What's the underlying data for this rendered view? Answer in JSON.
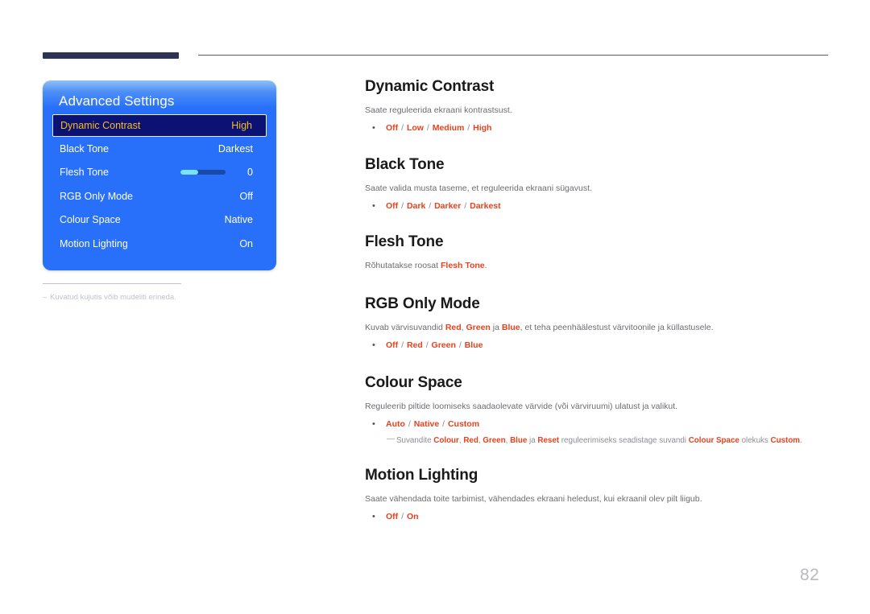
{
  "page": {
    "number": "82"
  },
  "osd": {
    "title": "Advanced Settings",
    "rows": [
      {
        "label": "Dynamic Contrast",
        "value": "High",
        "selected": true,
        "type": "value"
      },
      {
        "label": "Black Tone",
        "value": "Darkest",
        "selected": false,
        "type": "value"
      },
      {
        "label": "Flesh Tone",
        "value": "0",
        "selected": false,
        "type": "slider",
        "fill_percent": 40
      },
      {
        "label": "RGB Only Mode",
        "value": "Off",
        "selected": false,
        "type": "value"
      },
      {
        "label": "Colour Space",
        "value": "Native",
        "selected": false,
        "type": "value"
      },
      {
        "label": "Motion Lighting",
        "value": "On",
        "selected": false,
        "type": "value"
      }
    ],
    "note": {
      "dash": "–",
      "text": "Kuvatud kujutis võib mudeliti erineda."
    },
    "colors": {
      "panel_blue": "#2870fa",
      "selected_bg": "#0c1273",
      "selected_text": "#f5bd20",
      "slider_fill": "#7ae3ef",
      "slider_track": "#1a4aa8"
    }
  },
  "doc": {
    "accent_color": "#e8421d",
    "sections": [
      {
        "title": "Dynamic Contrast",
        "desc_prefix": "Saate reguleerida ekraani kontrastsust.",
        "bullet_dot": "•",
        "options": [
          "Off",
          "Low",
          "Medium",
          "High"
        ],
        "separator": "/"
      },
      {
        "title": "Black Tone",
        "desc_prefix": "Saate valida musta taseme, et reguleerida ekraani sügavust.",
        "bullet_dot": "•",
        "options": [
          "Off",
          "Dark",
          "Darker",
          "Darkest"
        ],
        "separator": "/"
      },
      {
        "title": "Flesh Tone",
        "desc_prefix": "Rõhutatakse roosat ",
        "desc_highlight": "Flesh Tone",
        "desc_suffix": ".",
        "options": [],
        "separator": "/"
      },
      {
        "title": "RGB Only Mode",
        "desc_part1": "Kuvab värvisuvandid ",
        "desc_hl1": "Red",
        "desc_part2": ", ",
        "desc_hl2": "Green",
        "desc_part3": " ja ",
        "desc_hl3": "Blue",
        "desc_part4": ", et teha peenhäälestust värvitoonile ja küllastusele.",
        "bullet_dot": "•",
        "options": [
          "Off",
          "Red",
          "Green",
          "Blue"
        ],
        "separator": "/"
      },
      {
        "title": "Colour Space",
        "desc_prefix": "Reguleerib piltide loomiseks saadaolevate värvide (või värviruumi) ulatust ja valikut.",
        "bullet_dot": "•",
        "options": [
          "Auto",
          "Native",
          "Custom"
        ],
        "separator": "/",
        "subnote": {
          "dash": "—",
          "p1": "Suvandite ",
          "h1": "Colour",
          "p2": ", ",
          "h2": "Red",
          "p3": ", ",
          "h3": "Green",
          "p4": ", ",
          "h4": "Blue",
          "p5": " ja ",
          "h5": "Reset",
          "p6": " reguleerimiseks seadistage suvandi ",
          "h6": "Colour Space",
          "p7": " olekuks ",
          "h7": "Custom",
          "p8": "."
        }
      },
      {
        "title": "Motion Lighting",
        "desc_prefix": "Saate vähendada toite tarbimist, vähendades ekraani heledust, kui ekraanil olev pilt liigub.",
        "bullet_dot": "•",
        "options": [
          "Off",
          "On"
        ],
        "separator": "/"
      }
    ]
  }
}
